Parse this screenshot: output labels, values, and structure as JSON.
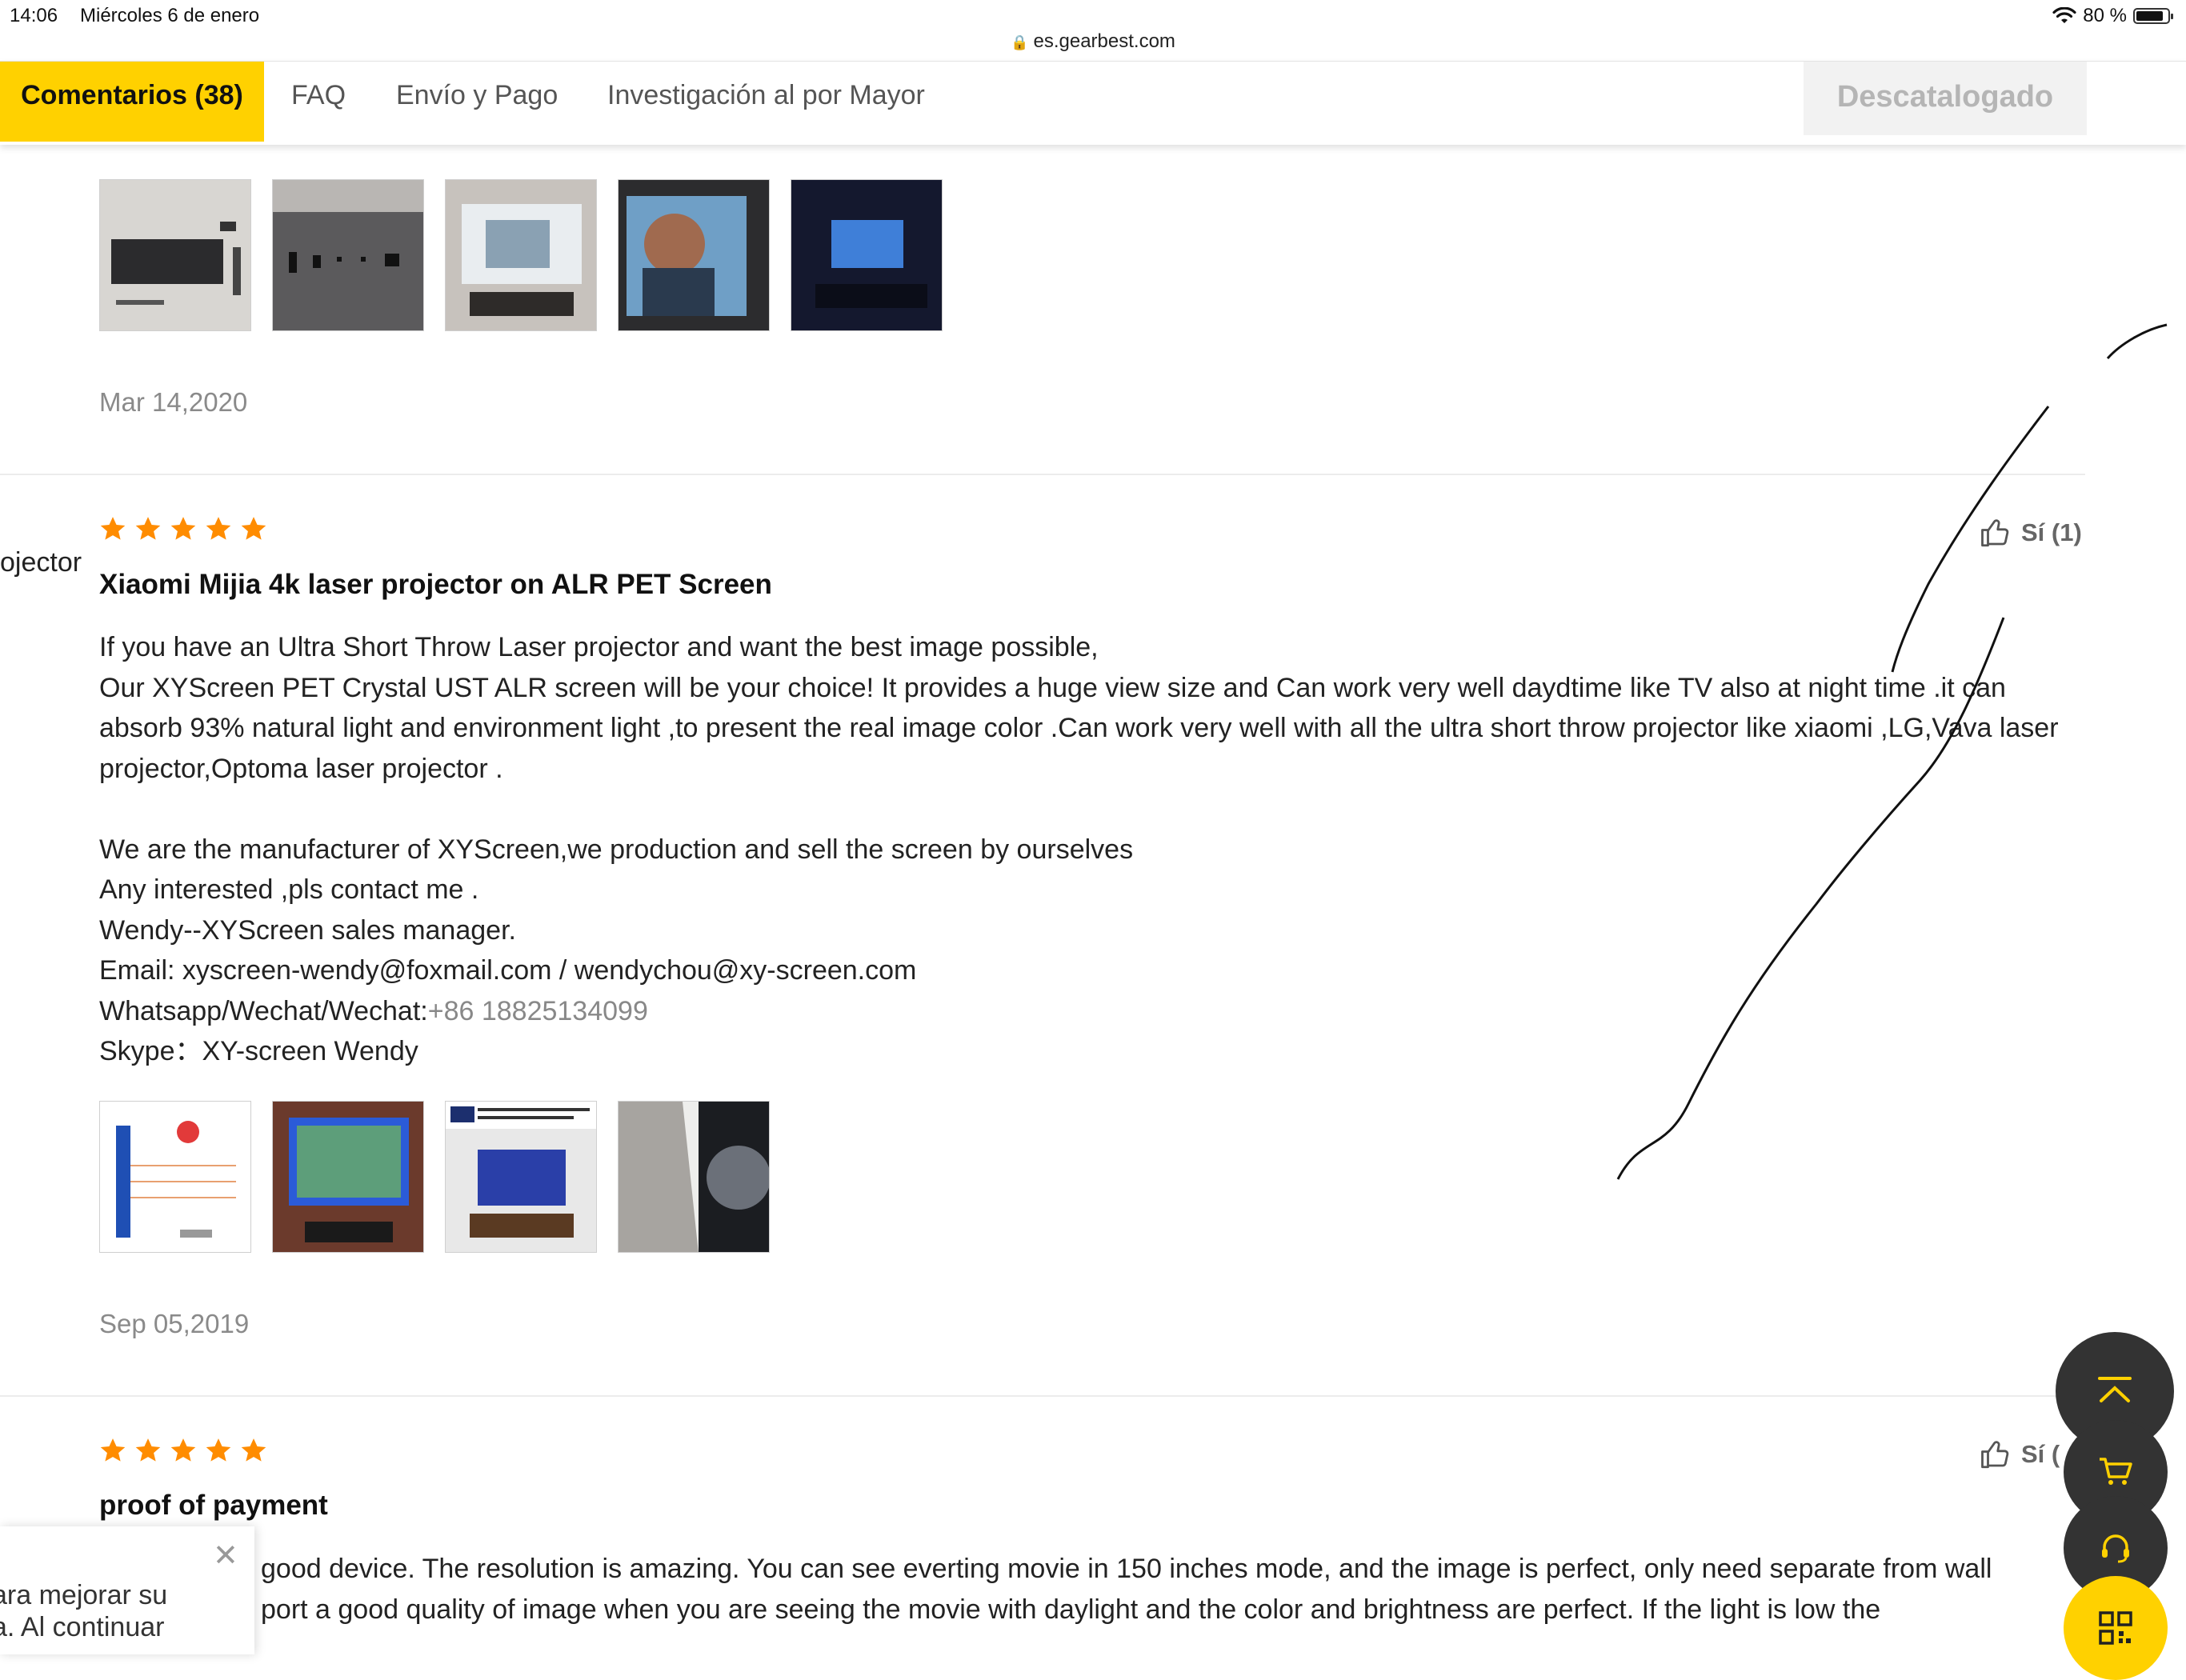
{
  "status_bar": {
    "time": "14:06",
    "date": "Miércoles 6 de enero",
    "battery": "80 %",
    "battery_level": 0.8,
    "wifi_icon": "wifi-icon"
  },
  "browser": {
    "url": "es.gearbest.com"
  },
  "tabs": {
    "items": [
      {
        "label": "Comentarios (38)",
        "active": true
      },
      {
        "label": "FAQ"
      },
      {
        "label": "Envío y Pago"
      },
      {
        "label": "Investigación al por Mayor"
      }
    ],
    "discontinued_button": "Descatalogado"
  },
  "colors": {
    "accent": "#ffd100",
    "star": "#ff8c00",
    "fab_dark": "#333333"
  },
  "reviews": [
    {
      "date": "Mar 14,2020",
      "photos": [
        "projector-unit-photo",
        "projector-ports-photo",
        "projected-image-living-room-photo",
        "projected-movie-face-photo",
        "projector-night-room-photo"
      ]
    },
    {
      "rating": 5,
      "title": "Xiaomi Mijia 4k laser projector on ALR PET Screen",
      "helpful": "Sí (1)",
      "side_label": "ojector",
      "body": [
        "If you have an Ultra Short Throw Laser projector and want the best image possible,",
        "Our XYScreen PET Crystal UST ALR screen will be your choice! It provides a huge view size and Can work very well daydtime like TV also at night time .it can absorb 93% natural light and environment light ,to present the real image color .Can work very well with all the ultra short throw projector like xiaomi ,LG,Vava laser projector,Optoma laser projector .",
        "",
        "We are the manufacturer of XYScreen,we production and sell the screen by ourselves",
        "Any interested ,pls contact me .",
        "Wendy--XYScreen sales manager.",
        "Email: xyscreen-wendy@foxmail.com / wendychou@xy-screen.com"
      ],
      "whatsapp_label": "Whatsapp/Wechat/Wechat:",
      "whatsapp_phone": "+86 18825134099",
      "skype": "Skype：XY-screen Wendy",
      "photos": [
        "screen-diagram-photo",
        "screen-installed-photo",
        "screen-ad-photo",
        "screen-micrograph-photo"
      ],
      "date": "Sep 05,2019"
    },
    {
      "rating": 5,
      "title": "proof of payment",
      "helpful": "Sí (",
      "body_line1": "good device. The resolution is amazing. You can see everting movie in 150 inches mode, and the image is perfect, only need separate from wall",
      "body_line2": "port a good quality of image when you are seeing the movie with daylight and the color and brightness are perfect. If the light is low the"
    }
  ],
  "cookie_notice": {
    "line1": "ara mejorar su",
    "line2": "a. Al continuar"
  },
  "floating": {
    "top_icon": "scroll-to-top-icon",
    "cart_icon": "cart-icon",
    "support_icon": "headset-icon",
    "qr_icon": "qr-code-icon"
  }
}
